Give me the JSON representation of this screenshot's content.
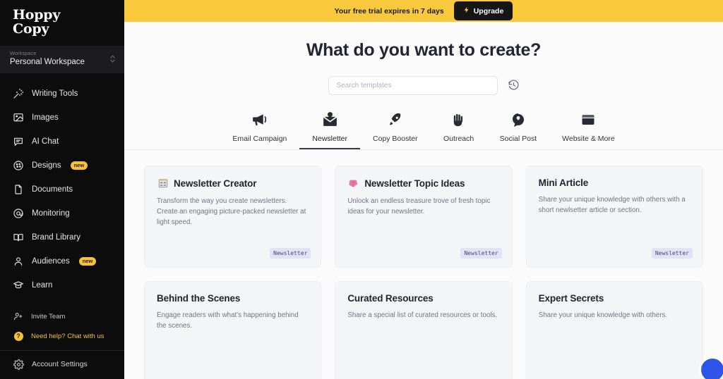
{
  "sidebar": {
    "logo_line1": "Hoppy",
    "logo_line2": "Copy",
    "workspace_label": "Workspace",
    "workspace_name": "Personal Workspace",
    "nav": [
      {
        "label": "Writing Tools",
        "icon": "magic-wand-icon",
        "badge": ""
      },
      {
        "label": "Images",
        "icon": "image-icon",
        "badge": ""
      },
      {
        "label": "AI Chat",
        "icon": "chat-bubble-icon",
        "badge": ""
      },
      {
        "label": "Designs",
        "icon": "palette-icon",
        "badge": "new"
      },
      {
        "label": "Documents",
        "icon": "document-icon",
        "badge": ""
      },
      {
        "label": "Monitoring",
        "icon": "at-sign-icon",
        "badge": ""
      },
      {
        "label": "Brand Library",
        "icon": "book-icon",
        "badge": ""
      },
      {
        "label": "Audiences",
        "icon": "user-icon",
        "badge": "new"
      },
      {
        "label": "Learn",
        "icon": "graduation-cap-icon",
        "badge": ""
      }
    ],
    "footer": {
      "invite": "Invite Team",
      "invite_icon": "user-plus-icon",
      "help": "Need help? Chat with us",
      "help_icon": "question-circle-icon",
      "account": "Account Settings",
      "account_icon": "gear-icon"
    }
  },
  "trial": {
    "message": "Your free trial expires in 7 days",
    "upgrade_label": "Upgrade",
    "upgrade_icon": "lightning-bolt-icon",
    "bar_color": "#f8c93c"
  },
  "hero": {
    "heading": "What do you want to create?"
  },
  "search": {
    "placeholder": "Search templates",
    "value": "",
    "history_icon": "history-clock-icon"
  },
  "tabs": [
    {
      "label": "Email Campaign",
      "icon": "megaphone-icon",
      "active": false
    },
    {
      "label": "Newsletter",
      "icon": "envelope-heart-icon",
      "active": true
    },
    {
      "label": "Copy Booster",
      "icon": "rocket-icon",
      "active": false
    },
    {
      "label": "Outreach",
      "icon": "waving-hand-icon",
      "active": false
    },
    {
      "label": "Social Post",
      "icon": "speech-bubble-icon",
      "active": false
    },
    {
      "label": "Website & More",
      "icon": "browser-window-icon",
      "active": false
    }
  ],
  "cards": [
    {
      "title": "Newsletter Creator",
      "description": "Transform the way you create newsletters. Create an engaging picture-packed newsletter at light speed.",
      "icon": "newspaper-icon",
      "tag": "Newsletter"
    },
    {
      "title": "Newsletter Topic Ideas",
      "description": "Unlock an endless treasure trove of fresh topic ideas for your newsletter.",
      "icon": "brain-icon",
      "tag": "Newsletter"
    },
    {
      "title": "Mini Article",
      "description": "Share your unique knowledge with others with a short newlsetter article or section.",
      "icon": "",
      "tag": "Newsletter"
    },
    {
      "title": "Behind the Scenes",
      "description": "Engage readers with what's happening behind the scenes.",
      "icon": "",
      "tag": ""
    },
    {
      "title": "Curated Resources",
      "description": "Share a special list of curated resources or tools.",
      "icon": "",
      "tag": ""
    },
    {
      "title": "Expert Secrets",
      "description": "Share your unique knowledge with others.",
      "icon": "",
      "tag": ""
    }
  ],
  "chat_widget": {
    "icon": "chat-support-icon",
    "color": "#2f54e8"
  }
}
